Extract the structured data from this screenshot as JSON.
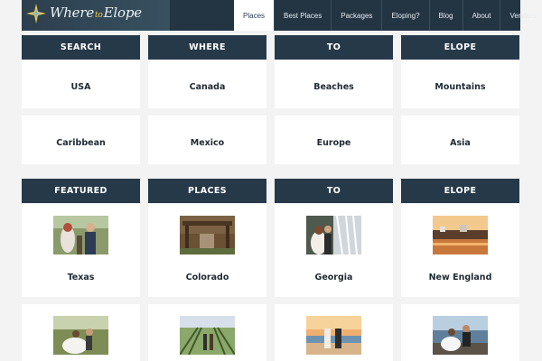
{
  "site": {
    "logo_text": [
      "Where",
      "to",
      "Elope"
    ]
  },
  "nav": {
    "items": [
      "Places",
      "Best Places",
      "Packages",
      "Eloping?",
      "Blog",
      "About",
      "Vendors"
    ],
    "active": "Places"
  },
  "search_banners": [
    "SEARCH",
    "WHERE",
    "TO",
    "ELOPE"
  ],
  "search_tiles_row1": [
    "USA",
    "Canada",
    "Beaches",
    "Mountains"
  ],
  "search_tiles_row2": [
    "Caribbean",
    "Mexico",
    "Europe",
    "Asia"
  ],
  "featured_banners": [
    "FEATURED",
    "PLACES",
    "TO",
    "ELOPE"
  ],
  "featured_places": [
    "Texas",
    "Colorado",
    "Georgia",
    "New England"
  ],
  "photo_subjects": [
    "wedding-couple-photo",
    "gazebo-photo",
    "waterfall-couple-photo",
    "harbor-sunset-photo",
    "garden-couple-photo",
    "vineyard-couple-photo",
    "beach-sunset-couple-photo",
    "rocky-coast-couple-photo"
  ],
  "colors": {
    "header": "#233443",
    "banner": "#263949",
    "background": "#f3f3f3"
  }
}
